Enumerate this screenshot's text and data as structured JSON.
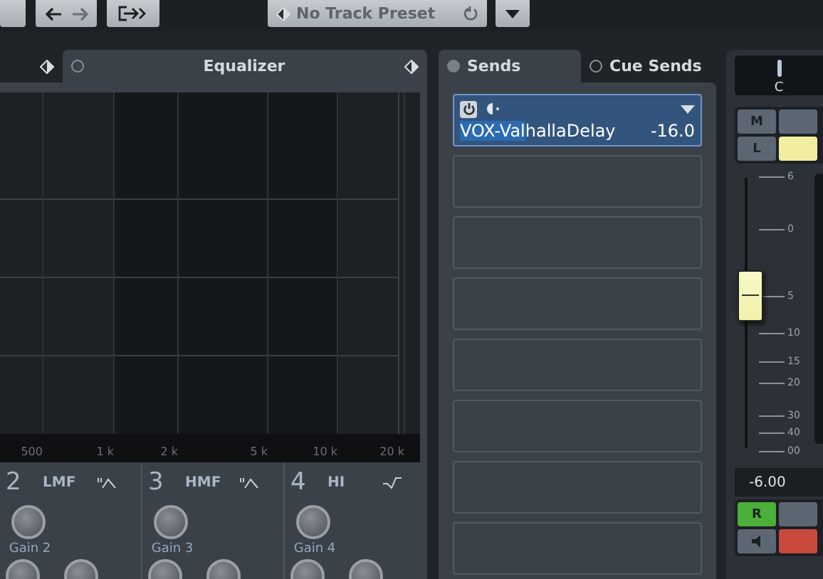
{
  "toolbar": {
    "preset": {
      "value": "No Track Preset"
    }
  },
  "equalizer": {
    "title": "Equalizer",
    "active": false,
    "frequency_labels": [
      "500",
      "1 k",
      "2 k",
      "5 k",
      "10 k",
      "20 k"
    ],
    "bands": [
      {
        "number": "2",
        "name": "LMF",
        "kind": "peak",
        "gain_label": "Gain 2"
      },
      {
        "number": "3",
        "name": "HMF",
        "kind": "peak",
        "gain_label": "Gain 3"
      },
      {
        "number": "4",
        "name": "HI",
        "kind": "shelf",
        "gain_label": "Gain 4"
      }
    ]
  },
  "sends_tabs": [
    {
      "label": "Sends",
      "selected": true
    },
    {
      "label": "Cue Sends",
      "selected": false
    }
  ],
  "sends": [
    {
      "kind": "send",
      "highlighted_part": "VOX-Val",
      "rest": "hallaDelay",
      "value": "-16.0",
      "on": true,
      "selected": true
    },
    {
      "kind": "empty"
    },
    {
      "kind": "empty"
    },
    {
      "kind": "empty"
    },
    {
      "kind": "empty"
    },
    {
      "kind": "empty"
    },
    {
      "kind": "empty"
    },
    {
      "kind": "empty"
    }
  ],
  "channel": {
    "pan": {
      "label": "C",
      "level": 0.5
    },
    "top_buttons": [
      {
        "kind": "text",
        "label": "M"
      },
      {
        "kind": "text"
      },
      {
        "kind": "text",
        "label": "L"
      },
      {
        "kind": "text",
        "color": "#f2eea0"
      }
    ],
    "fader": {
      "level": 0.57,
      "scale": [
        "6",
        "0",
        "5",
        "10",
        "15",
        "20",
        "30",
        "40",
        "00"
      ]
    },
    "volume": "-6.00",
    "bottom_buttons": [
      {
        "kind": "text",
        "label": "R",
        "color": "#4caf3a"
      },
      {
        "kind": "text"
      },
      {
        "kind": "monitor"
      },
      {
        "kind": "text",
        "color": "#c94a3c"
      }
    ]
  }
}
